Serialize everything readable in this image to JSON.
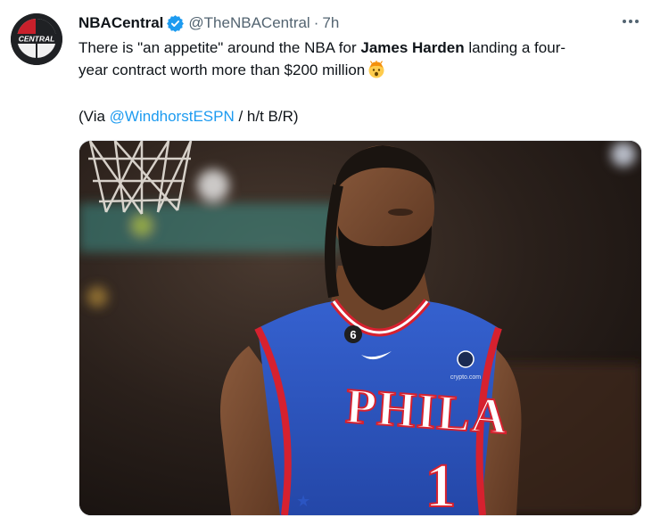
{
  "tweet": {
    "display_name": "NBACentral",
    "handle": "@TheNBACentral",
    "separator": "·",
    "time": "7h",
    "text_line1_pre": "There is \"an appetite\" around the NBA for ",
    "text_bold": "James Harden",
    "text_line1_post": " landing a four-",
    "text_line2": "year contract worth more than $200 million",
    "via_pre": "(Via ",
    "via_mention": "@WindhorstESPN",
    "via_post": " / h/t B/R)",
    "avatar_text": "CENTRAL",
    "jersey_text": "PHILA",
    "jersey_number": "1",
    "patch_number": "6",
    "sponsor_text": "crypto.com",
    "icons": [
      "verified-badge-icon",
      "more-options-icon",
      "exploding-head-emoji"
    ],
    "colors": {
      "accent": "#1d9bf0",
      "text": "#0f1419",
      "secondary": "#536471",
      "jersey_blue": "#2b55c2",
      "jersey_red": "#d6212f"
    }
  }
}
